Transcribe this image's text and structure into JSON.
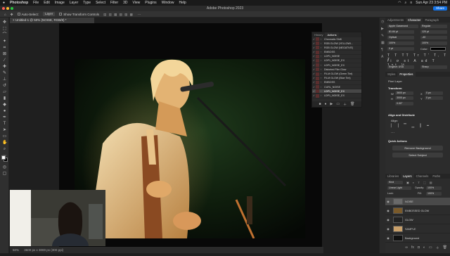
{
  "menubar": {
    "apple": "",
    "app": "Photoshop",
    "items": [
      "File",
      "Edit",
      "Image",
      "Layer",
      "Type",
      "Select",
      "Filter",
      "3D",
      "View",
      "Plugins",
      "Window",
      "Help"
    ],
    "datetime": "Sun Apr 23  3:54 PM"
  },
  "window": {
    "title": "Adobe Photoshop 2023",
    "share_label": "Share"
  },
  "options": {
    "auto_select_label": "Auto-Select:",
    "auto_select_value": "Layer",
    "transform_label": "Show Transform Controls"
  },
  "document": {
    "tab_label": "Untitled-1 @ 50% (NOISE, RGB/8) *",
    "zoom": "50%",
    "doc_info": "3600 px x 3000 px (300 ppi)"
  },
  "actions_panel": {
    "tabs": [
      "History",
      "Actions"
    ],
    "rows": [
      {
        "label": "Chromatic Shift",
        "indent": 0
      },
      {
        "label": "RGB GLOW (YELLOWI...",
        "indent": 0
      },
      {
        "label": "RGB GLOW (NEGATIVE)",
        "indent": 0
      },
      {
        "label": "EMBOSS",
        "indent": 0
      },
      {
        "label": "LDP1_NOISE",
        "indent": 0
      },
      {
        "label": "LDP1_NOISE_EX",
        "indent": 0
      },
      {
        "label": "LDP1_NOISE_EX",
        "indent": 0
      },
      {
        "label": "Distorted Film Glow",
        "indent": 0
      },
      {
        "label": "FILM GLOW (Green Tint)",
        "indent": 0
      },
      {
        "label": "FILM GLOW (Blue Tint)",
        "indent": 0
      },
      {
        "label": "EMBOSS",
        "indent": 0
      },
      {
        "label": "CURL_NOISE",
        "indent": 0
      },
      {
        "label": "LDP1_NOISE_EX",
        "indent": 0
      },
      {
        "label": "LDP1_NOISE_EX",
        "indent": 0
      }
    ]
  },
  "character_panel": {
    "tabs": [
      "Adjustments",
      "Character",
      "Paragraph"
    ],
    "font": "Apple Garamond",
    "style": "Regular",
    "size": "81.84 pt",
    "leading": "120 pt",
    "tracking": "Optical",
    "kerning": "-40",
    "vscale": "100%",
    "hscale": "100%",
    "baseline": "0 pt",
    "color_label": "Color:",
    "language": "English: USA",
    "aa": "Sharp"
  },
  "properties_panel": {
    "tabs": [
      "Styles",
      "Properties"
    ],
    "layer_type": "Pixel Layer",
    "transform_label": "Transform",
    "w": "3600 px",
    "h": "3000 px",
    "x": "0 px",
    "y": "0 px",
    "angle": "0.00°",
    "align_label": "Align and Distribute",
    "align_sub": "Align:",
    "quick_actions_label": "Quick Actions",
    "remove_bg": "Remove Background",
    "select_subject": "Select Subject"
  },
  "layers_panel": {
    "tabs": [
      "Libraries",
      "Layers",
      "Channels",
      "Paths"
    ],
    "kind": "Kind",
    "blend": "Linear Light",
    "opacity_label": "Opacity:",
    "opacity": "100%",
    "lock_label": "Lock:",
    "fill_label": "Fill:",
    "fill": "100%",
    "layers": [
      {
        "name": "NOISE",
        "selected": true
      },
      {
        "name": "EMBOSSED GLOW",
        "selected": false
      },
      {
        "name": "GLOW",
        "selected": false
      },
      {
        "name": "SAMPLE",
        "selected": false
      },
      {
        "name": "Background",
        "selected": false
      }
    ]
  }
}
